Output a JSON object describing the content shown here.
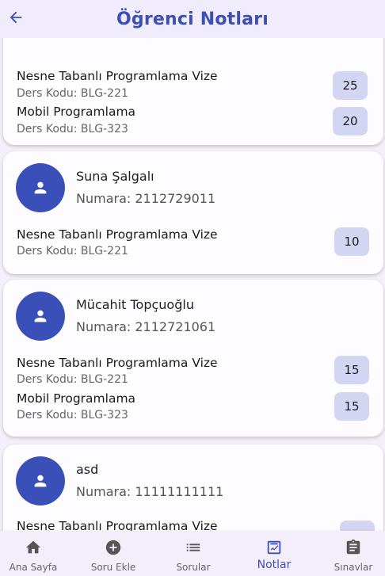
{
  "header": {
    "title": "Öğrenci Notları",
    "back_icon": "arrow-back-icon"
  },
  "colors": {
    "accent": "#3b4fb5",
    "avatar": "#3a4fb8",
    "badge": "#d3d6f2",
    "background": "#f4f0fa"
  },
  "students": [
    {
      "name": "",
      "number": "",
      "courses": [
        {
          "name": "Nesne Tabanlı Programlama Vize",
          "code": "Ders Kodu: BLG-221",
          "grade": "25"
        },
        {
          "name": "Mobil Programlama",
          "code": "Ders Kodu: BLG-323",
          "grade": "20"
        }
      ]
    },
    {
      "name": "Suna Şalgalı",
      "number": "Numara: 2112729011",
      "courses": [
        {
          "name": "Nesne Tabanlı Programlama Vize",
          "code": "Ders Kodu: BLG-221",
          "grade": "10"
        }
      ]
    },
    {
      "name": "Mücahit Topçuoğlu",
      "number": "Numara: 2112721061",
      "courses": [
        {
          "name": "Nesne Tabanlı Programlama Vize",
          "code": "Ders Kodu: BLG-221",
          "grade": "15"
        },
        {
          "name": "Mobil Programlama",
          "code": "Ders Kodu: BLG-323",
          "grade": "15"
        }
      ]
    },
    {
      "name": "asd",
      "number": "Numara: 11111111111",
      "courses": [
        {
          "name": "Nesne Tabanlı Programlama Vize",
          "code": "",
          "grade": ""
        }
      ]
    }
  ],
  "nav": [
    {
      "label": "Ana Sayfa",
      "icon": "home-icon"
    },
    {
      "label": "Soru Ekle",
      "icon": "add-circle-icon"
    },
    {
      "label": "Sorular",
      "icon": "list-icon"
    },
    {
      "label": "Notlar",
      "icon": "chart-icon",
      "active": true
    },
    {
      "label": "Sınavlar",
      "icon": "assignment-icon"
    }
  ]
}
